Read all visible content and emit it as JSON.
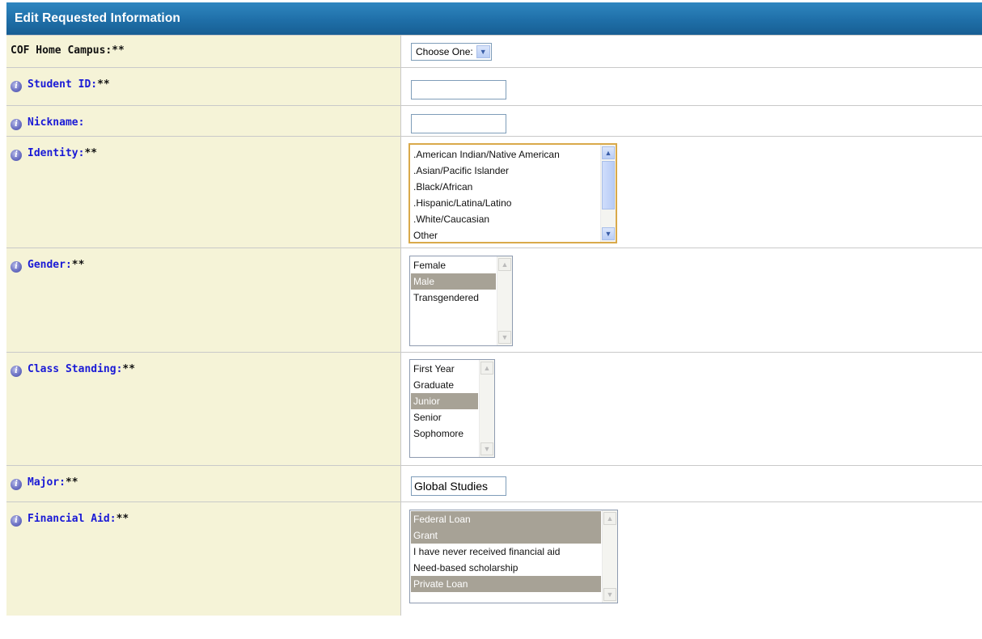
{
  "header": {
    "title": "Edit Requested Information"
  },
  "fields": {
    "campus": {
      "label": "COF Home Campus:",
      "required": "**",
      "selected": "Choose One:"
    },
    "student_id": {
      "label": "Student ID:",
      "required": "**",
      "value": ""
    },
    "nickname": {
      "label": "Nickname:",
      "required": "",
      "value": ""
    },
    "identity": {
      "label": "Identity:",
      "required": "**",
      "options": [
        ".American Indian/Native American",
        ".Asian/Pacific Islander",
        ".Black/African",
        ".Hispanic/Latina/Latino",
        ".White/Caucasian",
        "Other"
      ]
    },
    "gender": {
      "label": "Gender:",
      "required": "**",
      "options": [
        "Female",
        "Male",
        "Transgendered"
      ],
      "selected": [
        "Male"
      ]
    },
    "class_standing": {
      "label": "Class Standing:",
      "required": "**",
      "options": [
        "First Year",
        "Graduate",
        "Junior",
        "Senior",
        "Sophomore"
      ],
      "selected": [
        "Junior"
      ]
    },
    "major": {
      "label": "Major:",
      "required": "**",
      "value": "Global Studies"
    },
    "financial_aid": {
      "label": "Financial Aid:",
      "required": "**",
      "options": [
        "Federal Loan",
        "Grant",
        "I have never received financial aid",
        "Need-based scholarship",
        "Private Loan"
      ],
      "selected": [
        "Federal Loan",
        "Grant",
        "Private Loan"
      ]
    }
  },
  "icons": {
    "info": "info-icon",
    "dropdown": "chevron-down-icon",
    "scroll_up": "scroll-up-arrow-icon",
    "scroll_down": "scroll-down-arrow-icon"
  },
  "colors": {
    "header": "#1f6fa8",
    "label_bg": "#f5f3d7",
    "label_text": "#1a1ad6",
    "selected_option": "#a7a296"
  }
}
